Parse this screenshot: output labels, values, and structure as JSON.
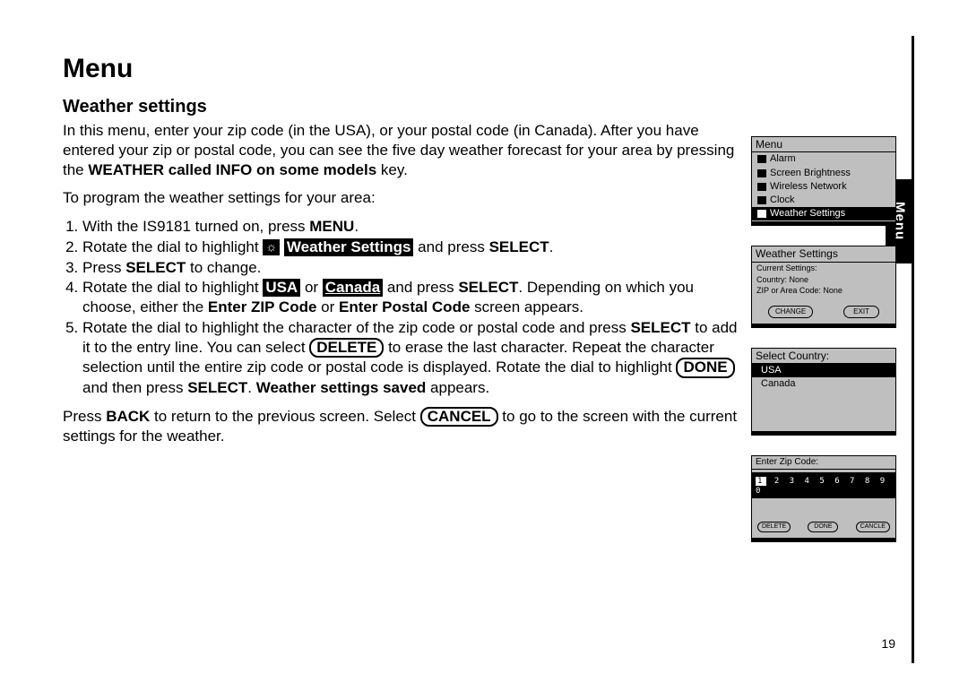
{
  "title": "Menu",
  "subtitle": "Weather settings",
  "sideTab": "Menu",
  "pageNumber": "19",
  "intro": {
    "p1a": "In this menu, enter your zip code (in the USA), or your postal code (in Canada). After you have entered your zip or postal code, you can see the five day weather forecast for your area by pressing the ",
    "p1b_bold": "WEATHER called INFO on some models",
    "p1c": " key.",
    "p2": "To program the weather settings for your area:"
  },
  "steps": {
    "s1a": "With the IS9181 turned on, press ",
    "s1b_bold": "MENU",
    "s1c": ".",
    "s2a": "Rotate the dial to highlight ",
    "s2_icon": "☼",
    "s2b_inv": "Weather Settings",
    "s2c": " and press ",
    "s2d_bold": "SELECT",
    "s2e": ".",
    "s3a": "Press ",
    "s3b_bold": "SELECT",
    "s3c": " to change.",
    "s4a": "Rotate the dial to highlight ",
    "s4b_inv": "USA",
    "s4c": " or ",
    "s4d_inv": "Canada",
    "s4e": " and press ",
    "s4f_bold": "SELECT",
    "s4g": ". Depending on which you choose, either the ",
    "s4h_bold": "Enter ZIP Code",
    "s4i": " or ",
    "s4j_bold": "Enter Postal Code",
    "s4k": " screen appears.",
    "s5a": "Rotate the dial to highlight the character of the zip code or postal code and press ",
    "s5b_bold": "SELECT",
    "s5c": " to add it to the entry line. You can select ",
    "s5d_pill": "DELETE",
    "s5e": " to erase the last character. Repeat the character selection until the entire zip code or postal code is displayed. Rotate the dial to highlight ",
    "s5f_pill": "DONE",
    "s5g": " and then press ",
    "s5h_bold": "SELECT",
    "s5i": ". ",
    "s5j_bold": "Weather settings saved",
    "s5k": " appears."
  },
  "outro": {
    "a": "Press ",
    "b_bold": "BACK",
    "c": " to return to the previous screen. Select ",
    "d_pill": "CANCEL",
    "e": " to go to the screen with the current settings for the weather."
  },
  "screens": {
    "menu": {
      "header": "Menu",
      "items": [
        "Alarm",
        "Screen Brightness",
        "Wireless Network",
        "Clock",
        "Weather Settings"
      ],
      "selectedIndex": 4
    },
    "weather": {
      "header": "Weather Settings",
      "lines": [
        "Current Settings:",
        "Country: None",
        "ZIP or Area Code: None"
      ],
      "buttons": [
        "CHANGE",
        "EXIT"
      ]
    },
    "country": {
      "header": "Select Country:",
      "items": [
        "USA",
        "Canada"
      ],
      "selectedIndex": 0
    },
    "zip": {
      "header": "Enter Zip Code:",
      "digits_hl": "1",
      "digits_rest": "2 3 4 5 6 7 8 9 0",
      "buttons": [
        "DELETE",
        "DONE",
        "CANCLE"
      ]
    }
  }
}
